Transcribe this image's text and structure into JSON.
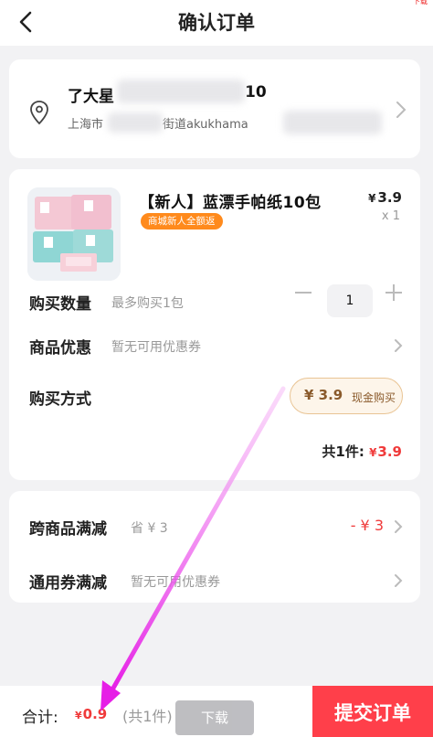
{
  "header": {
    "title": "确认订单",
    "back_icon": "back-arrow-icon",
    "corner_text": "下载"
  },
  "address": {
    "name": "了大星",
    "name_tail": "10",
    "detail_prefix": "上海市",
    "detail_mid": "街道akukhama",
    "pin_icon": "location-pin-icon"
  },
  "product": {
    "title": "【新人】蓝漂手帕纸10包",
    "badge": "商城新人全额返",
    "price_currency": "¥",
    "price": "3.9",
    "qty": "x 1",
    "rows": {
      "quantity_label": "购买数量",
      "quantity_hint": "最多购买1包",
      "quantity_value": "1",
      "discount_label": "商品优惠",
      "discount_hint": "暂无可用优惠券",
      "method_label": "购买方式",
      "method_amount": "¥ 3.9",
      "method_text": "现金购买"
    },
    "summary_prefix": "共1件:",
    "summary_currency": "¥",
    "summary_value": "3.9"
  },
  "promos": {
    "cross_label": "跨商品满减",
    "cross_hint": "省 ¥ 3",
    "cross_value": "- ¥ 3",
    "coupon_label": "通用券满减",
    "coupon_hint": "暂无可用优惠券"
  },
  "bottom_bar": {
    "total_label": "合计:",
    "total_currency": "¥",
    "total_value": "0.9",
    "count_text": "(共1件)",
    "download_label": "下载",
    "submit_label": "提交订单"
  },
  "colors": {
    "accent_red": "#ff3f4a",
    "price_red": "#f03a3a",
    "badge_orange": "#ff8a1c",
    "annotation_magenta": "#e61ee6"
  }
}
